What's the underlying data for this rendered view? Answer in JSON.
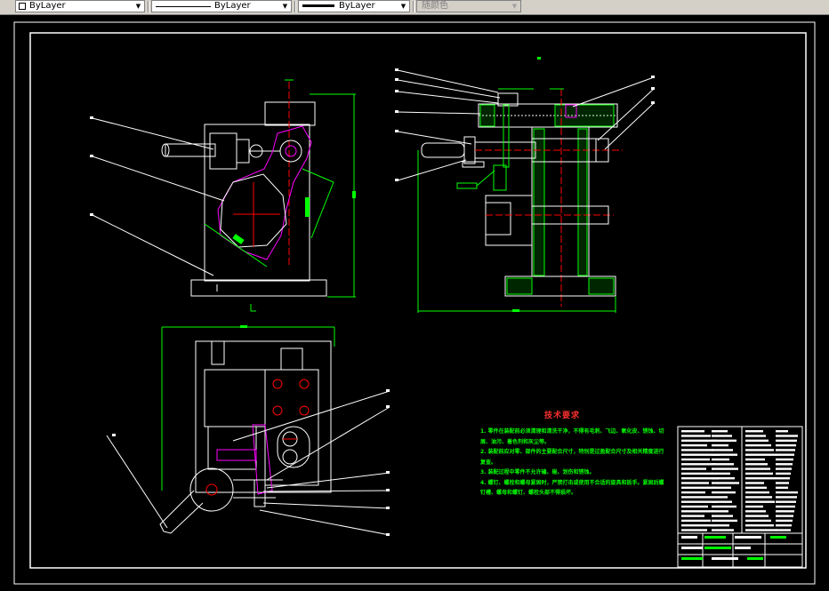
{
  "toolbar": {
    "color_combo": "ByLayer",
    "linetype_combo": "ByLayer",
    "lineweight_combo": "ByLayer",
    "plotstyle_combo": "随颜色"
  },
  "drawing": {
    "tech_title": "技术要求",
    "tech_lines": [
      "1. 零件在装配前必须清理和清洗干净，不得有毛刺、飞边、氧化皮、锈蚀、切",
      "屑、油污、着色剂和灰尘等。",
      "2. 装配前应对零、部件的主要配合尺寸，特别是过盈配合尺寸及相关精度进行",
      "复查。",
      "3. 装配过程中零件不允许磕、碰、划伤和锈蚀。",
      "4. 螺钉、螺栓和螺母紧固时，严禁打击或使用不合适的旋具和扳手。紧固后螺",
      "钉槽、螺母和螺钉、螺栓头部不得损坏。"
    ],
    "colors": {
      "background": "#000000",
      "frame": "#ffffff",
      "magenta": "#ff00ff",
      "green": "#00ff00",
      "red": "#ff0000",
      "yellow": "#ffff00"
    }
  }
}
